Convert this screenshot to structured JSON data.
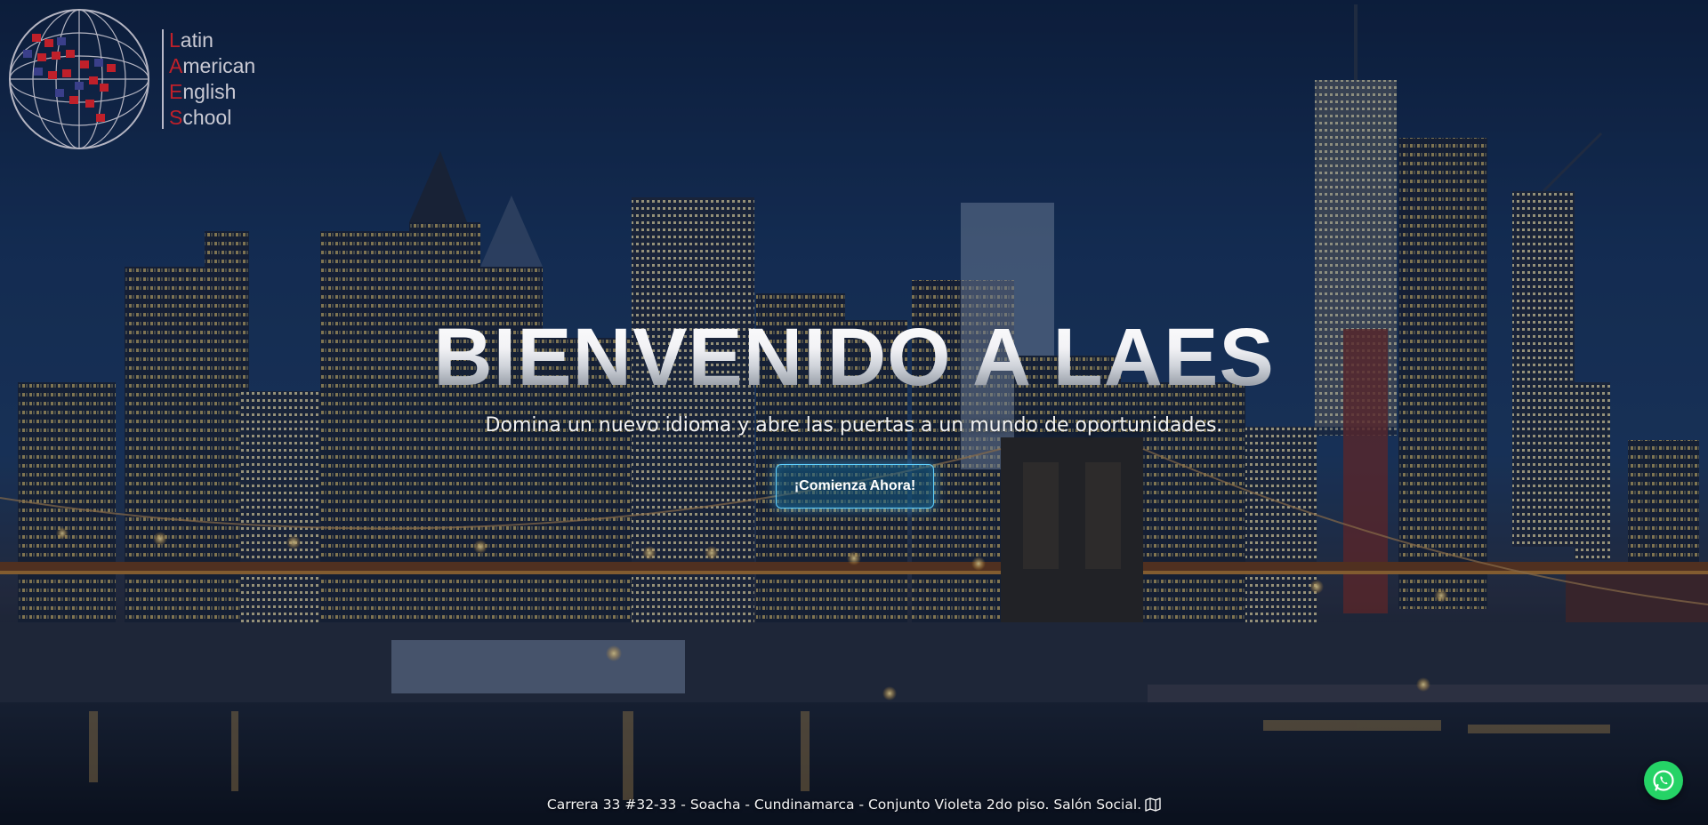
{
  "logo": {
    "lines": [
      {
        "first": "L",
        "rest": "atin"
      },
      {
        "first": "A",
        "rest": "merican"
      },
      {
        "first": "E",
        "rest": "nglish"
      },
      {
        "first": "S",
        "rest": "chool"
      }
    ]
  },
  "hero": {
    "headline": "BIENVENIDO A LAES",
    "subtitle": "Domina un nuevo idioma y abre las puertas a un mundo de oportunidades.",
    "cta_label": "¡Comienza Ahora!"
  },
  "footer": {
    "address": "Carrera 33 #32-33 - Soacha - Cundinamarca - Conjunto Violeta 2do piso. Salón Social.",
    "map_icon": "map-icon"
  },
  "floating": {
    "whatsapp_icon": "whatsapp-icon"
  },
  "colors": {
    "accent": "#5fd0ff",
    "logo_red": "#c0202a",
    "whatsapp": "#25d366"
  }
}
